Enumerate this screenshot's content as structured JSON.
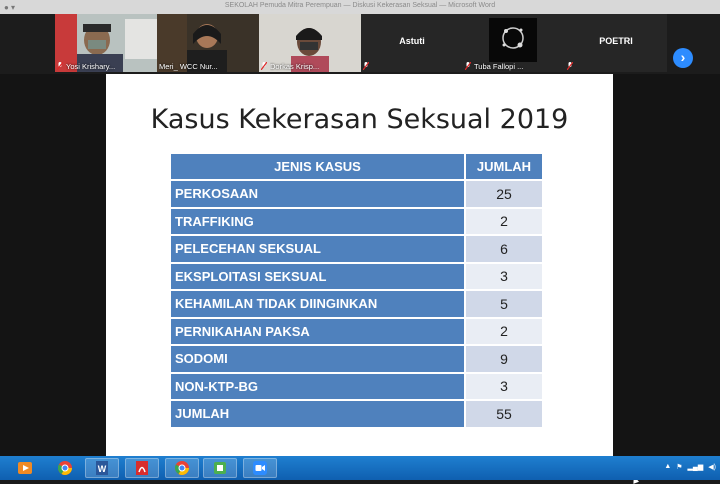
{
  "window": {
    "title": "SEKOLAH Pemuda Mitra Perempuan — Diskusi Kekerasan Seksual — Microsoft Word"
  },
  "gallery": {
    "participants": [
      {
        "name": "Yosi Krishary...",
        "muted": true
      },
      {
        "name": "Meri_ WCC Nur...",
        "muted": false,
        "active": true
      },
      {
        "name": "Dorkas Krisp...",
        "muted": true
      },
      {
        "name": "Astuti",
        "muted": true
      },
      {
        "name": "Tuba Fallopi ...",
        "muted": true
      },
      {
        "name": "POETRI",
        "muted": true
      }
    ],
    "next_icon": "chevron-right-icon"
  },
  "slide": {
    "title": "Kasus Kekerasan Seksual 2019",
    "table": {
      "headers": [
        "JENIS KASUS",
        "JUMLAH"
      ],
      "rows": [
        [
          "PERKOSAAN",
          "25"
        ],
        [
          "TRAFFIKING",
          "2"
        ],
        [
          "PELECEHAN SEKSUAL",
          "6"
        ],
        [
          "EKSPLOITASI SEKSUAL",
          "3"
        ],
        [
          "KEHAMILAN TIDAK DIINGINKAN",
          "5"
        ],
        [
          "PERNIKAHAN PAKSA",
          "2"
        ],
        [
          "SODOMI",
          "9"
        ],
        [
          "NON-KTP-BG",
          "3"
        ],
        [
          "JUMLAH",
          "55"
        ]
      ]
    }
  },
  "taskbar": {
    "apps": [
      {
        "name": "media-player-icon",
        "color": "#f08a24"
      },
      {
        "name": "chrome-icon",
        "color": "#e94235"
      },
      {
        "name": "word-icon",
        "color": "#2b579a"
      },
      {
        "name": "acrobat-icon",
        "color": "#d92d2d"
      },
      {
        "name": "chrome-icon",
        "color": "#e94235"
      },
      {
        "name": "app-icon",
        "color": "#4caf50"
      },
      {
        "name": "zoom-icon",
        "color": "#2d8cff"
      }
    ]
  }
}
